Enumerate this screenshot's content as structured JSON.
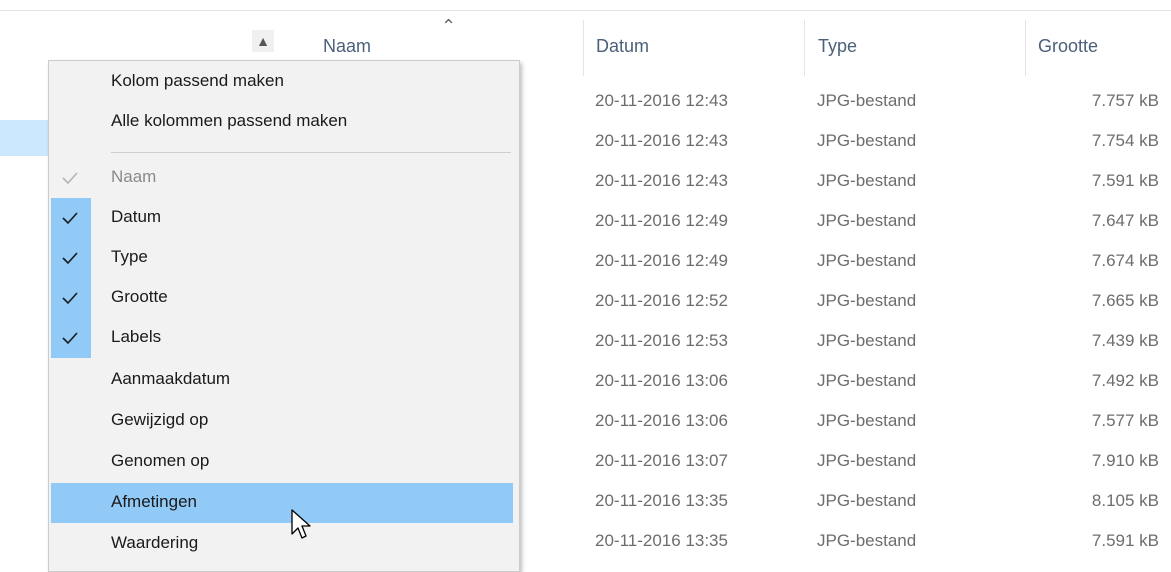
{
  "columns": {
    "name": "Naam",
    "date": "Datum",
    "type": "Type",
    "size": "Grootte"
  },
  "files": [
    {
      "date": "20-11-2016 12:43",
      "type": "JPG-bestand",
      "size": "7.757 kB"
    },
    {
      "date": "20-11-2016 12:43",
      "type": "JPG-bestand",
      "size": "7.754 kB"
    },
    {
      "date": "20-11-2016 12:43",
      "type": "JPG-bestand",
      "size": "7.591 kB"
    },
    {
      "date": "20-11-2016 12:49",
      "type": "JPG-bestand",
      "size": "7.647 kB"
    },
    {
      "date": "20-11-2016 12:49",
      "type": "JPG-bestand",
      "size": "7.674 kB"
    },
    {
      "date": "20-11-2016 12:52",
      "type": "JPG-bestand",
      "size": "7.665 kB"
    },
    {
      "date": "20-11-2016 12:53",
      "type": "JPG-bestand",
      "size": "7.439 kB"
    },
    {
      "date": "20-11-2016 13:06",
      "type": "JPG-bestand",
      "size": "7.492 kB"
    },
    {
      "date": "20-11-2016 13:06",
      "type": "JPG-bestand",
      "size": "7.577 kB"
    },
    {
      "date": "20-11-2016 13:07",
      "type": "JPG-bestand",
      "size": "7.910 kB"
    },
    {
      "date": "20-11-2016 13:35",
      "type": "JPG-bestand",
      "size": "8.105 kB"
    },
    {
      "date": "20-11-2016 13:35",
      "type": "JPG-bestand",
      "size": "7.591 kB"
    }
  ],
  "menu": {
    "fit_column": "Kolom passend maken",
    "fit_all_columns": "Alle kolommen passend maken",
    "items": [
      {
        "label": "Naam",
        "checked": true,
        "disabled": true
      },
      {
        "label": "Datum",
        "checked": true
      },
      {
        "label": "Type",
        "checked": true
      },
      {
        "label": "Grootte",
        "checked": true
      },
      {
        "label": "Labels",
        "checked": true
      },
      {
        "label": "Aanmaakdatum",
        "checked": false
      },
      {
        "label": "Gewijzigd op",
        "checked": false
      },
      {
        "label": "Genomen op",
        "checked": false
      },
      {
        "label": "Afmetingen",
        "checked": false,
        "hovered": true
      },
      {
        "label": "Waardering",
        "checked": false
      }
    ]
  },
  "colors": {
    "menu_highlight": "#91c9f7",
    "selection": "#cce8ff",
    "header_text": "#4c607a"
  },
  "icons": [
    "chevron-up-icon",
    "sort-ascending-icon",
    "checkmark-icon",
    "mouse-pointer-icon"
  ]
}
